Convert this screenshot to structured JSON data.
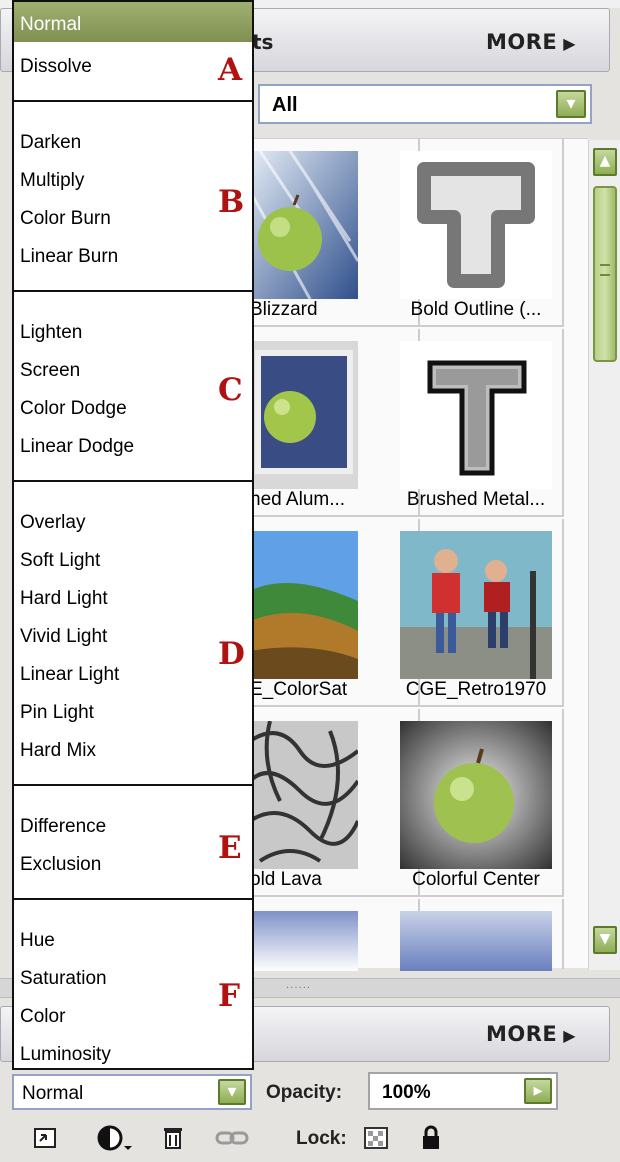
{
  "panel": {
    "header_tab_fragment": "ts",
    "more_label": "MORE",
    "more_arrow": "▶",
    "filter": {
      "value": "All",
      "arrow": "▾"
    },
    "effects": [
      {
        "caption": "Blizzard"
      },
      {
        "caption": "Bold Outline (..."
      },
      {
        "caption": "hed Alum..."
      },
      {
        "caption": "Brushed Metal..."
      },
      {
        "caption": "E_ColorSat"
      },
      {
        "caption": "CGE_Retro1970"
      },
      {
        "caption": "old Lava"
      },
      {
        "caption": "Colorful Center"
      }
    ],
    "scroll_up": "▲",
    "scroll_down": "▼",
    "divider_grip": "······"
  },
  "layers": {
    "more_label": "MORE",
    "more_arrow": "▶",
    "blend_mode_value": "Normal",
    "blend_arrow": "▾",
    "opacity_label": "Opacity:",
    "opacity_value": "100%",
    "opacity_arrow": "▸",
    "lock_label": "Lock:",
    "toolbar_icons": [
      "link-layers-icon",
      "adjustment-layer-icon",
      "trash-icon",
      "chain-link-icon",
      "lock-transparency-icon",
      "lock-all-icon"
    ]
  },
  "blend_menu": {
    "selected": "Normal",
    "groups": [
      {
        "letter": "A",
        "items": [
          "Normal",
          "Dissolve"
        ]
      },
      {
        "letter": "B",
        "items": [
          "Darken",
          "Multiply",
          "Color Burn",
          "Linear Burn"
        ]
      },
      {
        "letter": "C",
        "items": [
          "Lighten",
          "Screen",
          "Color Dodge",
          "Linear Dodge"
        ]
      },
      {
        "letter": "D",
        "items": [
          "Overlay",
          "Soft Light",
          "Hard Light",
          "Vivid Light",
          "Linear Light",
          "Pin Light",
          "Hard Mix"
        ]
      },
      {
        "letter": "E",
        "items": [
          "Difference",
          "Exclusion"
        ]
      },
      {
        "letter": "F",
        "items": [
          "Hue",
          "Saturation",
          "Color",
          "Luminosity"
        ]
      }
    ]
  },
  "colors": {
    "accent_green": "#8fad55",
    "menu_highlight": "#8fa060",
    "group_letter": "#b01212"
  }
}
